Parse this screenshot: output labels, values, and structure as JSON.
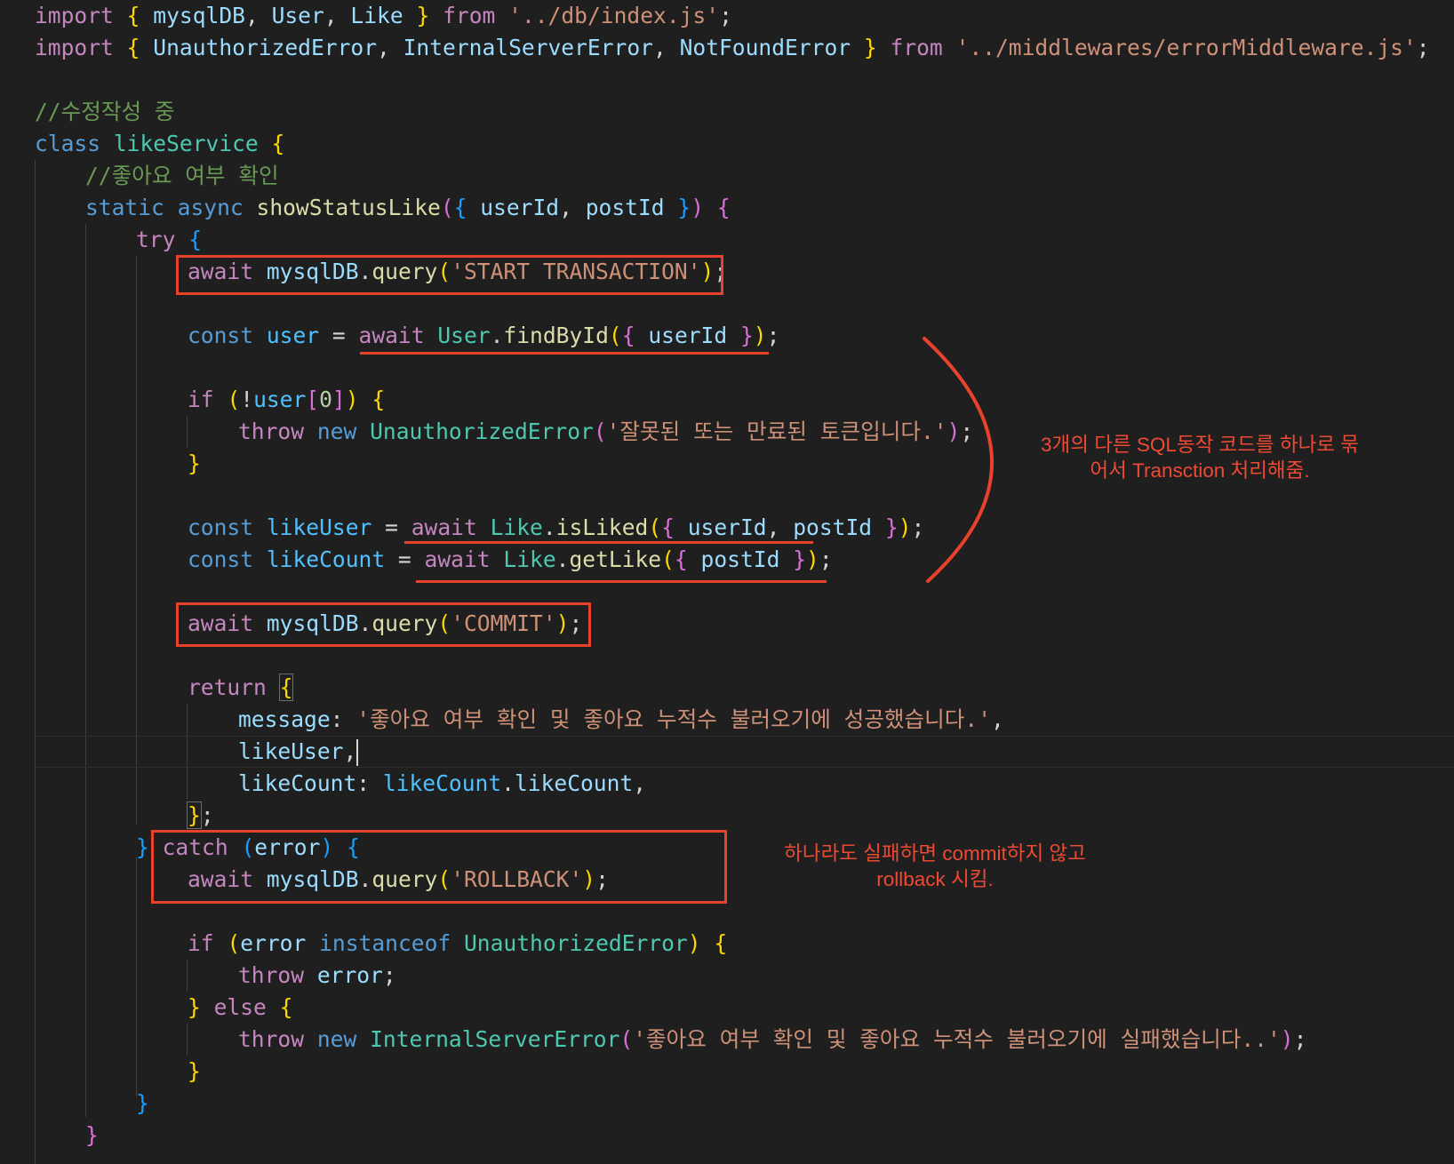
{
  "code": {
    "import_db_path": "'../db/index.js'",
    "import_err_path": "'../middlewares/errorMiddleware.js'",
    "comment_top": "//수정작성 중",
    "class_name": "likeService",
    "comment_method": "//좋아요 여부 확인",
    "method_name": "showStatusLike",
    "q_start": "'START TRANSACTION'",
    "unauthorized_msg": "'잘못된 또는 만료된 토큰입니다.'",
    "q_commit": "'COMMIT'",
    "success_msg": "'좋아요 여부 확인 및 좋아요 누적수 불러오기에 성공했습니다.'",
    "q_rollback": "'ROLLBACK'",
    "fail_msg": "'좋아요 여부 확인 및 좋아요 누적수 불러오기에 실패했습니다..'",
    "index_zero": "0"
  },
  "annotations": {
    "transaction_line1": "3개의 다른 SQL동작 코드를 하나로 묶",
    "transaction_line2": "어서 Transction 처리해줌.",
    "rollback_line1": "하나라도 실패하면 commit하지 않고",
    "rollback_line2": "rollback 시킴."
  },
  "colors": {
    "background": "#1f1f1f",
    "annotation_red": "#e8412c"
  }
}
